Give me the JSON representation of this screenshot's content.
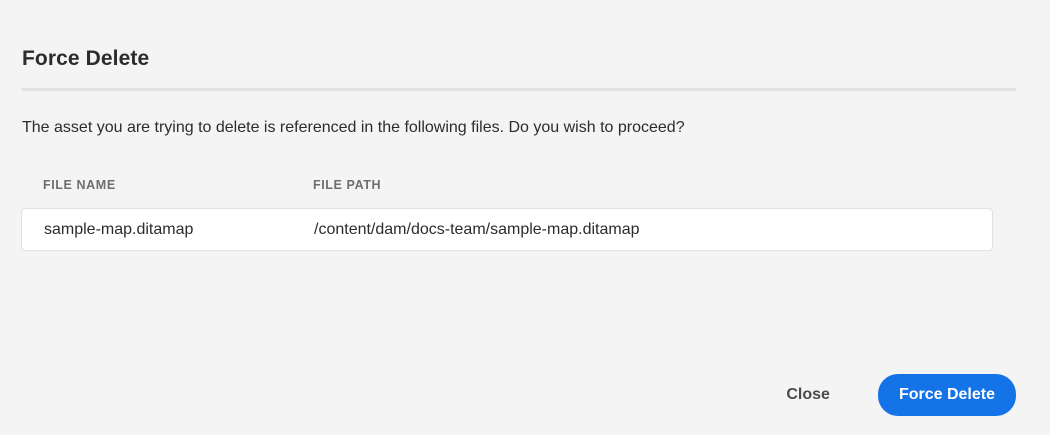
{
  "dialog": {
    "title": "Force Delete",
    "message": "The asset you are trying to delete is referenced in the following files. Do you wish to proceed?"
  },
  "table": {
    "columns": [
      "FILE NAME",
      "FILE PATH"
    ],
    "rows": [
      {
        "file_name": "sample-map.ditamap",
        "file_path": "/content/dam/docs-team/sample-map.ditamap"
      }
    ]
  },
  "footer": {
    "close_label": "Close",
    "force_delete_label": "Force Delete"
  },
  "colors": {
    "background": "#f4f4f4",
    "accent": "#1473e6",
    "row_background": "#ffffff"
  }
}
